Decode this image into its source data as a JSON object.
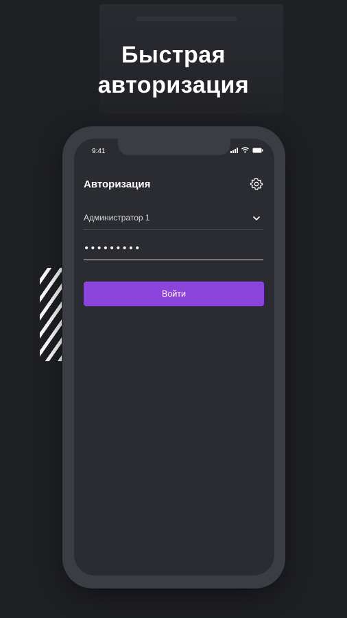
{
  "headline": {
    "line1": "Быстрая",
    "line2": "авторизация"
  },
  "status_bar": {
    "time": "9:41"
  },
  "screen": {
    "title": "Авторизация",
    "user_select": {
      "value": "Администратор 1"
    },
    "password": {
      "value": "•••••••••"
    },
    "login_button": {
      "label": "Войти"
    }
  },
  "icons": {
    "settings": "gear-icon",
    "dropdown": "chevron-down-icon",
    "signal": "signal-icon",
    "wifi": "wifi-icon",
    "battery": "battery-icon"
  },
  "colors": {
    "background": "#1f2024",
    "phone_frame": "#3a3d44",
    "screen_bg": "#2a2c31",
    "accent": "#8b45dc",
    "text": "#ffffff"
  }
}
